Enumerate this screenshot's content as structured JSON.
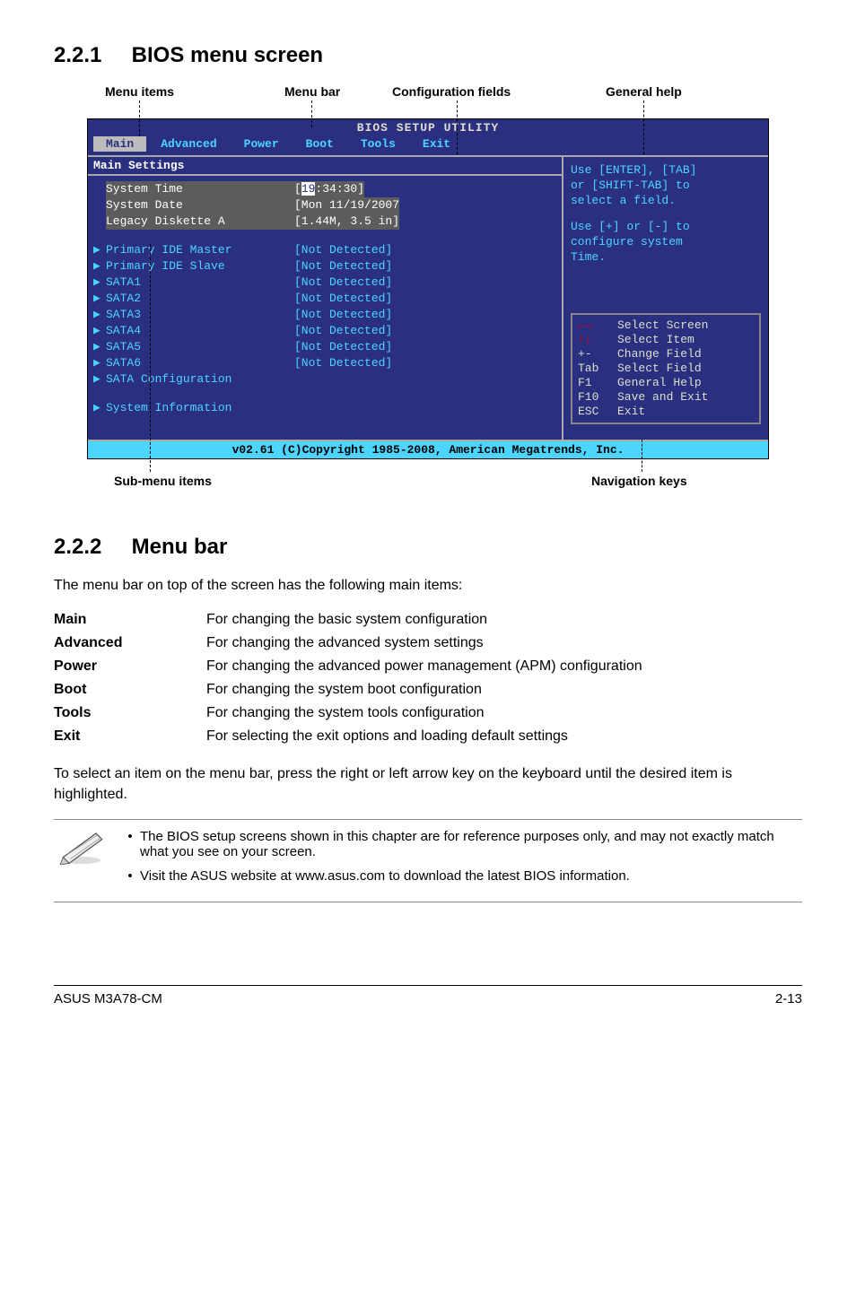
{
  "section1": {
    "num": "2.2.1",
    "title": "BIOS menu screen"
  },
  "annot": {
    "menu_items": "Menu items",
    "menu_bar": "Menu bar",
    "config_fields": "Configuration fields",
    "general_help": "General help",
    "sub_menu": "Sub-menu items",
    "nav_keys": "Navigation keys"
  },
  "bios": {
    "title": "BIOS SETUP UTILITY",
    "tabs": [
      "Main",
      "Advanced",
      "Power",
      "Boot",
      "Tools",
      "Exit"
    ],
    "selected_tab": "Main",
    "subheader": "Main Settings",
    "rows": {
      "system_time_k": "System Time",
      "system_time_v_pre": "[",
      "system_time_hl": "19",
      "system_time_v_post": ":34:30]",
      "system_date_k": "System Date",
      "system_date_v": "[Mon 11/19/2007",
      "legacy_k": "Legacy Diskette A",
      "legacy_v": "[1.44M, 3.5 in]",
      "pim_k": "Primary IDE Master",
      "pim_v": "[Not Detected]",
      "pis_k": "Primary IDE Slave",
      "pis_v": "[Not Detected]",
      "s1_k": "SATA1",
      "s1_v": "[Not Detected]",
      "s2_k": "SATA2",
      "s2_v": "[Not Detected]",
      "s3_k": "SATA3",
      "s3_v": "[Not Detected]",
      "s4_k": "SATA4",
      "s4_v": "[Not Detected]",
      "s5_k": "SATA5",
      "s5_v": "[Not Detected]",
      "s6_k": "SATA6",
      "s6_v": "[Not Detected]",
      "sc_k": "SATA Configuration",
      "si_k": "System Information"
    },
    "help": {
      "l1": "Use [ENTER], [TAB]",
      "l2": "or [SHIFT-TAB] to",
      "l3": "select a field.",
      "l4": "Use [+] or [-] to",
      "l5": "configure system",
      "l6": "Time."
    },
    "shortcuts": {
      "select_screen": "Select Screen",
      "select_item": "Select Item",
      "plus_minus": "+-",
      "change_field": "Change Field",
      "tab": "Tab",
      "select_field": "Select Field",
      "f1": "F1",
      "general_help": "General Help",
      "f10": "F10",
      "save_exit": "Save and Exit",
      "esc": "ESC",
      "exit": "Exit"
    },
    "footer": "v02.61 (C)Copyright 1985-2008, American Megatrends, Inc."
  },
  "section2": {
    "num": "2.2.2",
    "title": "Menu bar"
  },
  "intro2": "The menu bar on top of the screen has the following main items:",
  "defs": {
    "main_k": "Main",
    "main_v": "For changing the basic system configuration",
    "adv_k": "Advanced",
    "adv_v": "For changing the advanced system settings",
    "pow_k": "Power",
    "pow_v": "For changing the advanced power management (APM) configuration",
    "boot_k": "Boot",
    "boot_v": "For changing the system boot configuration",
    "tools_k": "Tools",
    "tools_v": "For changing the system tools configuration",
    "exit_k": "Exit",
    "exit_v": "For selecting the exit options and loading default settings"
  },
  "para": "To select an item on the menu bar, press the right or left arrow key on the keyboard until the desired item is highlighted.",
  "notes": {
    "n1": "The BIOS setup screens shown in this chapter are for reference purposes only, and may not exactly match what you see on your screen.",
    "n2": "Visit the ASUS website at www.asus.com to download the latest BIOS information."
  },
  "footer": {
    "left": "ASUS M3A78-CM",
    "right": "2-13"
  }
}
